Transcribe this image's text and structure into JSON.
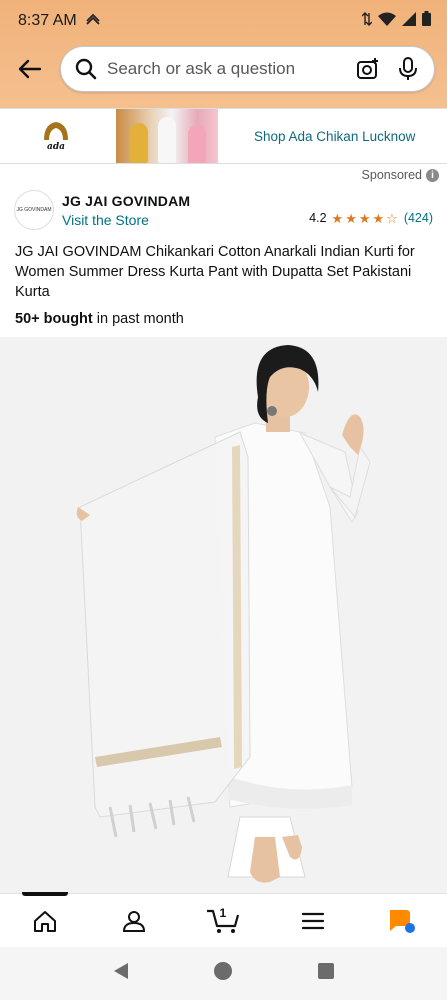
{
  "status_bar": {
    "time": "8:37 AM"
  },
  "search": {
    "placeholder": "Search or ask a question"
  },
  "ad": {
    "store_link": "Shop Ada Chikan Lucknow",
    "sponsored_label": "Sponsored"
  },
  "store": {
    "name": "JG JAI GOVINDAM",
    "visit_label": "Visit the Store",
    "logo_text": "JG GOVINDAM"
  },
  "rating": {
    "value": "4.2",
    "stars_filled": 4,
    "stars_total": 5,
    "count": "(424)"
  },
  "product": {
    "title": "JG JAI GOVINDAM Chikankari Cotton Anarkali Indian Kurti for Women Summer Dress Kurta Pant with Dupatta Set Pakistani Kurta",
    "bought_bold": "50+ bought",
    "bought_rest": " in past month"
  },
  "nav": {
    "items": [
      "home-icon",
      "account-icon",
      "cart-icon",
      "menu-icon",
      "rufus-icon"
    ],
    "cart_count": "1"
  },
  "colors": {
    "header": "#f5c08f",
    "link": "#007185",
    "star": "#de7921",
    "ad_link": "#0f6a7c"
  }
}
